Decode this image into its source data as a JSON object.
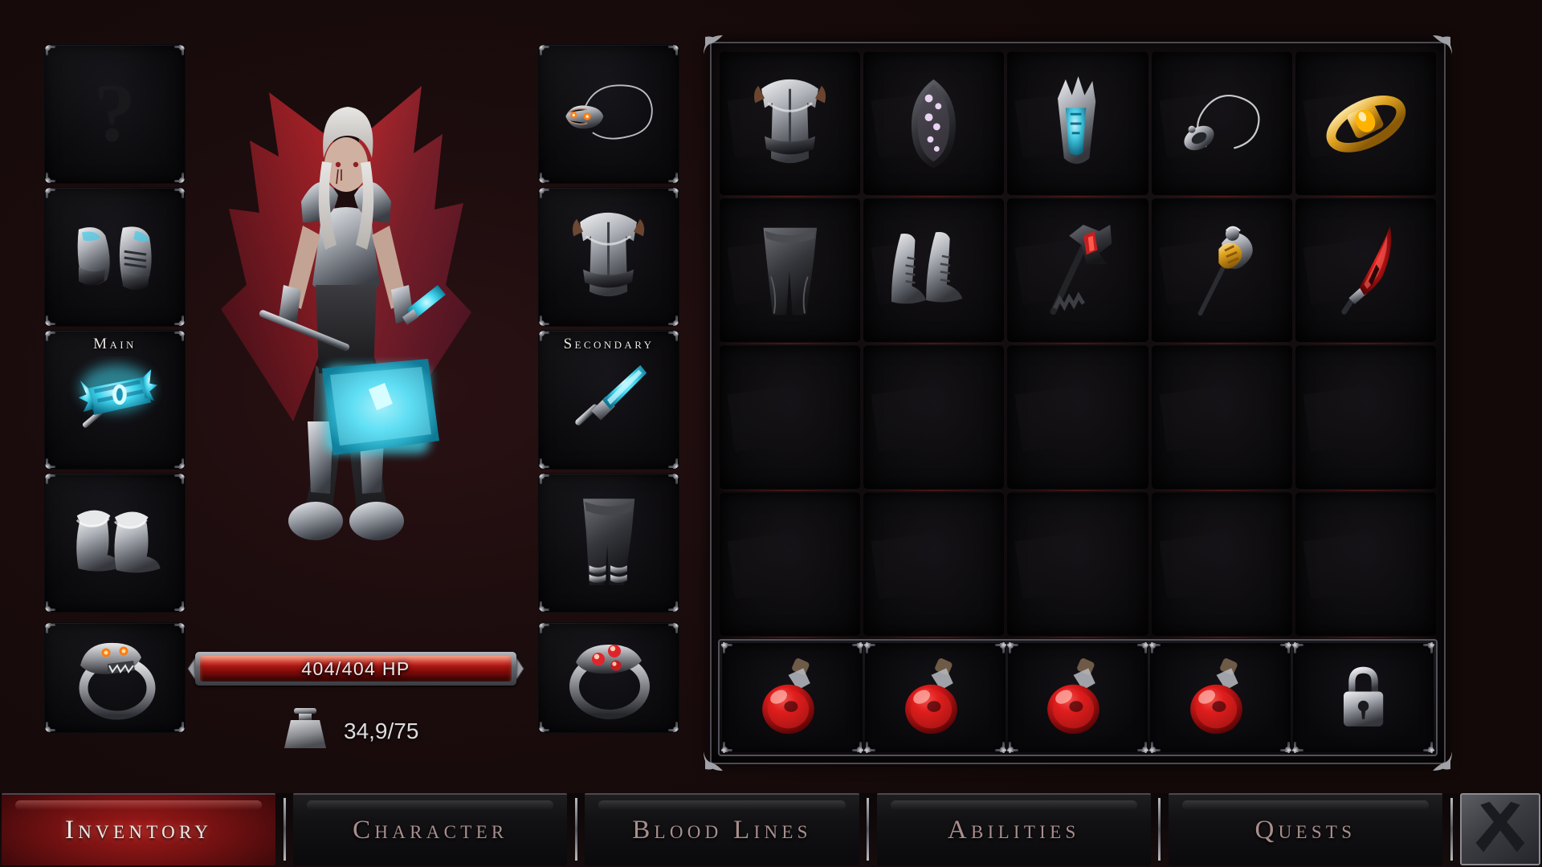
{
  "window": {
    "title": "Inventory"
  },
  "character": {
    "name": "vampire-knight",
    "hp": {
      "current": 404,
      "max": 404,
      "label": "404/404 HP",
      "suffix": "HP",
      "fill_percent": 100,
      "color": "#c11d16"
    },
    "weight": {
      "value": "34,9/75",
      "current": 34.9,
      "max": 75,
      "icon": "weight-anvil-icon"
    }
  },
  "equipment": {
    "left_column": [
      {
        "slot": "unknown",
        "label": "",
        "icon": "question-mark-icon",
        "empty": true,
        "item": ""
      },
      {
        "slot": "gauntlets",
        "label": "",
        "icon": "gauntlets-icon",
        "empty": false,
        "item": "Steel Gauntlets"
      },
      {
        "slot": "main-hand",
        "label": "Main",
        "icon": "glowing-hammer-icon",
        "empty": false,
        "item": "Frost Maul"
      },
      {
        "slot": "boots",
        "label": "",
        "icon": "fur-boots-icon",
        "empty": false,
        "item": "Fur Boots"
      }
    ],
    "right_column": [
      {
        "slot": "amulet",
        "label": "",
        "icon": "wolf-skull-amulet-icon",
        "empty": false,
        "item": "Wolf Skull Amulet"
      },
      {
        "slot": "chest",
        "label": "",
        "icon": "chest-armor-icon",
        "empty": false,
        "item": "Plate Cuirass"
      },
      {
        "slot": "off-hand",
        "label": "Secondary",
        "icon": "blue-dagger-icon",
        "empty": false,
        "item": "Frost Dagger"
      },
      {
        "slot": "legs",
        "label": "",
        "icon": "leather-pants-icon",
        "empty": false,
        "item": "Leather Greaves"
      }
    ],
    "ring_left": {
      "slot": "ring-1",
      "icon": "wolf-head-ring-icon",
      "item": "Wolf Head Ring",
      "empty": false
    },
    "ring_right": {
      "slot": "ring-2",
      "icon": "triple-gem-ring-icon",
      "item": "Triple Ruby Ring",
      "empty": false
    }
  },
  "inventory": {
    "columns": 5,
    "rows": 4,
    "slots": [
      {
        "index": 0,
        "icon": "chest-armor-icon",
        "item": "Knight Cuirass",
        "empty": false
      },
      {
        "index": 1,
        "icon": "gem-hood-icon",
        "item": "Gem Studded Hood",
        "empty": false
      },
      {
        "index": 2,
        "icon": "spiked-gauntlet-icon",
        "item": "Spiked Bracer",
        "empty": false
      },
      {
        "index": 3,
        "icon": "amulet-icon",
        "item": "Silver Amulet",
        "empty": false
      },
      {
        "index": 4,
        "icon": "gold-ring-icon",
        "item": "Amber Ring",
        "empty": false
      },
      {
        "index": 5,
        "icon": "pants-icon",
        "item": "Dark Trousers",
        "empty": false
      },
      {
        "index": 6,
        "icon": "boots-icon",
        "item": "Silver Boots",
        "empty": false
      },
      {
        "index": 7,
        "icon": "battle-axe-icon",
        "item": "Crimson Axe",
        "empty": false
      },
      {
        "index": 8,
        "icon": "gold-mace-icon",
        "item": "Gilded Mace",
        "empty": false
      },
      {
        "index": 9,
        "icon": "red-sword-icon",
        "item": "Blood Scimitar",
        "empty": false
      },
      {
        "index": 10,
        "icon": "",
        "item": "",
        "empty": true
      },
      {
        "index": 11,
        "icon": "",
        "item": "",
        "empty": true
      },
      {
        "index": 12,
        "icon": "",
        "item": "",
        "empty": true
      },
      {
        "index": 13,
        "icon": "",
        "item": "",
        "empty": true
      },
      {
        "index": 14,
        "icon": "",
        "item": "",
        "empty": true
      },
      {
        "index": 15,
        "icon": "",
        "item": "",
        "empty": true
      },
      {
        "index": 16,
        "icon": "",
        "item": "",
        "empty": true
      },
      {
        "index": 17,
        "icon": "",
        "item": "",
        "empty": true
      },
      {
        "index": 18,
        "icon": "",
        "item": "",
        "empty": true
      },
      {
        "index": 19,
        "icon": "",
        "item": "",
        "empty": true
      }
    ]
  },
  "quickbar": {
    "slots": [
      {
        "index": 0,
        "icon": "health-potion-icon",
        "item": "Health Potion",
        "locked": false,
        "empty": false
      },
      {
        "index": 1,
        "icon": "health-potion-icon",
        "item": "Health Potion",
        "locked": false,
        "empty": false
      },
      {
        "index": 2,
        "icon": "health-potion-icon",
        "item": "Health Potion",
        "locked": false,
        "empty": false
      },
      {
        "index": 3,
        "icon": "health-potion-icon",
        "item": "Health Potion",
        "locked": false,
        "empty": false
      },
      {
        "index": 4,
        "icon": "padlock-icon",
        "item": "",
        "locked": true,
        "empty": true
      }
    ]
  },
  "tabs": [
    {
      "id": "inventory",
      "label": "Inventory",
      "active": true
    },
    {
      "id": "character",
      "label": "Character",
      "active": false
    },
    {
      "id": "blood-lines",
      "label": "Blood Lines",
      "active": false
    },
    {
      "id": "abilities",
      "label": "Abilities",
      "active": false
    },
    {
      "id": "quests",
      "label": "Quests",
      "active": false
    }
  ],
  "close_button": {
    "icon": "close-x-icon",
    "label": ""
  },
  "theme": {
    "background": "#140a0b",
    "accent_red": "#a11a19",
    "hp_red": "#c11d16",
    "frame_silver": "#8b8c92",
    "text_muted": "#a98e8e",
    "text_bright": "#efe9e6",
    "glow_blue": "#3fd8ef"
  }
}
